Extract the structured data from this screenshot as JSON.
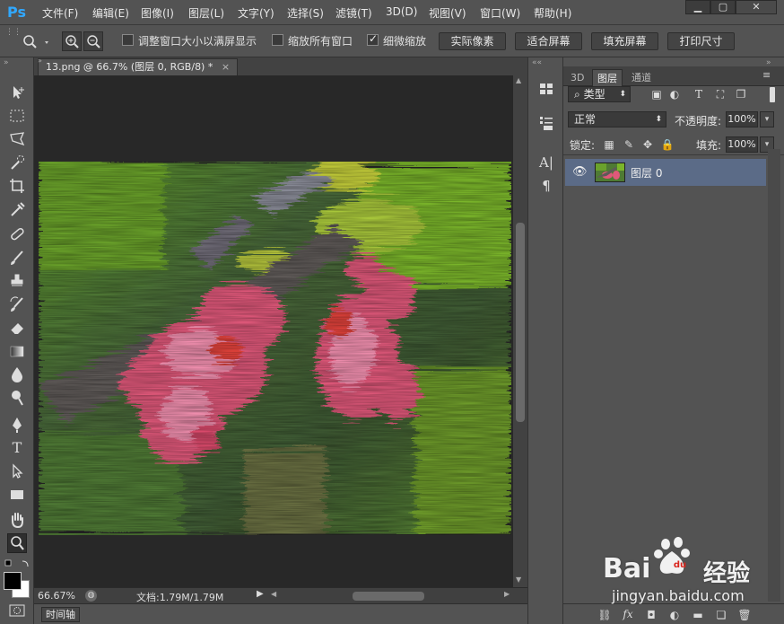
{
  "app": {
    "logo": "Ps"
  },
  "menu": [
    {
      "label": "文件(F)"
    },
    {
      "label": "编辑(E)"
    },
    {
      "label": "图像(I)"
    },
    {
      "label": "图层(L)"
    },
    {
      "label": "文字(Y)"
    },
    {
      "label": "选择(S)"
    },
    {
      "label": "滤镜(T)"
    },
    {
      "label": "3D(D)"
    },
    {
      "label": "视图(V)"
    },
    {
      "label": "窗口(W)"
    },
    {
      "label": "帮助(H)"
    }
  ],
  "window_controls": {
    "minimize": "▁",
    "maximize": "▢",
    "close": "✕"
  },
  "options": {
    "resize_windows_label": "调整窗口大小以满屏显示",
    "resize_windows_checked": false,
    "zoom_all_label": "缩放所有窗口",
    "zoom_all_checked": false,
    "scrubby_zoom_label": "细微缩放",
    "scrubby_zoom_checked": true,
    "actual_pixels_label": "实际像素",
    "fit_screen_label": "适合屏幕",
    "fill_screen_label": "填充屏幕",
    "print_size_label": "打印尺寸"
  },
  "document": {
    "tab_title": "13.png @ 66.7% (图层 0, RGB/8) *",
    "close_glyph": "×"
  },
  "status": {
    "zoom": "66.67%",
    "doc_info": "文档:1.79M/1.79M"
  },
  "timeline_label": "时间轴",
  "panel": {
    "tabs": [
      {
        "label": "3D"
      },
      {
        "label": "图层"
      },
      {
        "label": "通道"
      }
    ],
    "filter_kind": "类型",
    "blend_mode": "正常",
    "opacity_label": "不透明度:",
    "opacity_value": "100%",
    "lock_label": "锁定:",
    "fill_label": "填充:",
    "fill_value": "100%",
    "layers": [
      {
        "name": "图层 0",
        "visible": true
      }
    ]
  },
  "colors": {
    "ui_bg": "#535353",
    "canvas_bg": "#282828",
    "selected_layer": "#5b6b87",
    "ps_blue": "#31a8ff",
    "watermark_red": "#d9251d"
  },
  "watermark": {
    "brand_left": "Bai",
    "brand_right": "经验",
    "url": "jingyan.baidu.com"
  }
}
